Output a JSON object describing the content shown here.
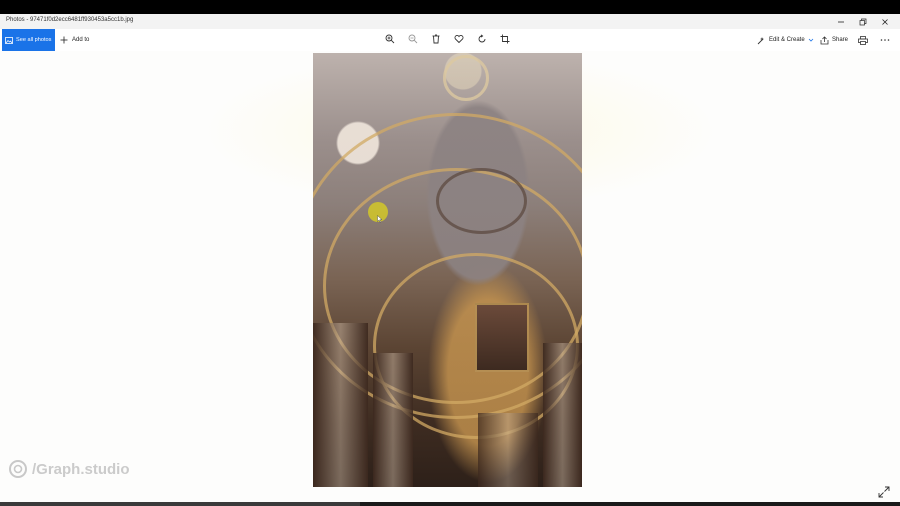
{
  "window": {
    "title": "Photos - 97471f0d2ecc6481ff930453a5cc1b.jpg",
    "controls": [
      "minimize-icon",
      "restore-icon",
      "close-icon"
    ]
  },
  "toolbar": {
    "see_all_label": "See all photos",
    "add_to_label": "Add to",
    "center_tools": [
      "zoom-in-icon",
      "zoom-out-icon",
      "delete-icon",
      "heart-icon",
      "rotate-icon",
      "crop-icon"
    ],
    "edit_create_label": "Edit & Create",
    "share_label": "Share",
    "accent": "#1a73e8"
  },
  "watermark": {
    "text": "/Graph.studio"
  },
  "cursor": {
    "color": "#d2c828"
  }
}
